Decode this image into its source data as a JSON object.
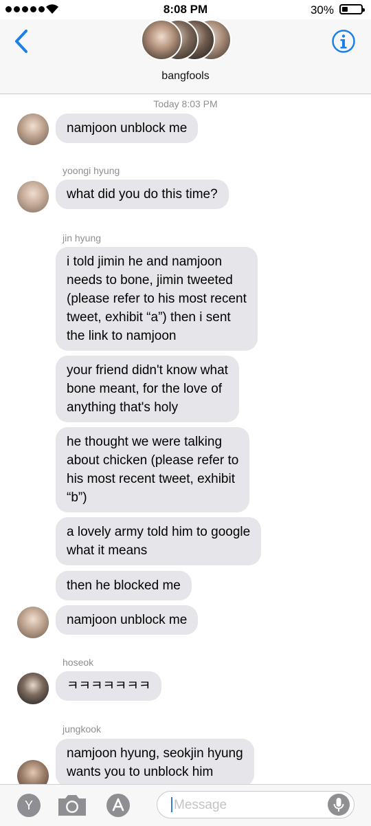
{
  "status_bar": {
    "time": "8:08 PM",
    "battery": "30%"
  },
  "header": {
    "group_name": "bangfools"
  },
  "chat": {
    "timestamp": "Today 8:03 PM",
    "messages": [
      {
        "text": "namjoon unblock me"
      },
      {
        "sender": "yoongi hyung",
        "text": "what did you do this time?"
      },
      {
        "sender": "jin hyung",
        "text": "i told jimin he and namjoon\nneeds to bone, jimin tweeted\n(please refer to his most recent\ntweet, exhibit “a”) then i sent\nthe link to namjoon"
      },
      {
        "text": "your friend didn't know what\nbone meant, for the love of\nanything that's holy"
      },
      {
        "text": "he thought we were talking\nabout chicken (please refer to\nhis most recent tweet, exhibit\n“b”)"
      },
      {
        "text": "a lovely army told him to google\nwhat it means"
      },
      {
        "text": "then he blocked me"
      },
      {
        "text": "namjoon unblock me"
      },
      {
        "sender": "hoseok",
        "text": "ㅋㅋㅋㅋㅋㅋㅋ"
      },
      {
        "sender": "jungkook",
        "text": "namjoon hyung, seokjin hyung\nwants you to unblock him"
      }
    ]
  },
  "input": {
    "placeholder": "Message",
    "y_label": "Y"
  },
  "colors": {
    "accent": "#1a7fe8",
    "bubble": "#e5e5ea",
    "meta": "#8e8e93"
  }
}
